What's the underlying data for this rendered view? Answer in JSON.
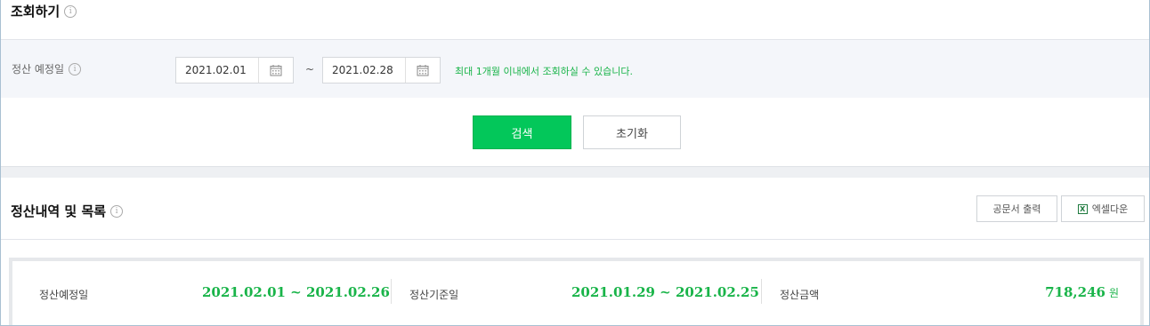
{
  "search_section": {
    "title": "조회하기",
    "filter_label": "정산 예정일",
    "start_date": "2021.02.01",
    "end_date": "2021.02.28",
    "range_separator": "~",
    "hint": "최대 1개월 이내에서 조회하실 수 있습니다.",
    "search_button": "검색",
    "reset_button": "초기화"
  },
  "list_section": {
    "title": "정산내역 및 목록",
    "print_button": "공문서 출력",
    "excel_button": "엑셀다운"
  },
  "summary": {
    "scheduled_label": "정산예정일",
    "scheduled_value": "2021.02.01 ~ 2021.02.26",
    "base_label": "정산기준일",
    "base_value": "2021.01.29 ~ 2021.02.25",
    "amount_label": "정산금액",
    "amount_value": "718,246",
    "amount_unit": "원"
  },
  "colors": {
    "accent_green": "#03c75a",
    "text_green": "#19b449"
  }
}
